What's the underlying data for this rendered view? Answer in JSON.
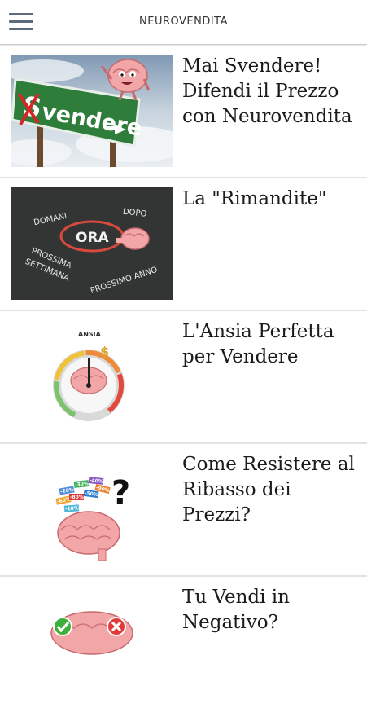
{
  "header": {
    "menu_icon": "hamburger-menu-icon",
    "title": "NEUROVENDITA"
  },
  "articles": [
    {
      "title": "Mai Svendere! Difendi il Prezzo con Neurovendita",
      "image": {
        "sign_text": "vendere",
        "sign_prefix": "S"
      }
    },
    {
      "title": "La \"Rimandite\"",
      "image": {
        "words": [
          "DOMANI",
          "DOPO",
          "ORA",
          "PROSSIMA",
          "SETTIMANA",
          "PROSSIMO ANNO"
        ]
      }
    },
    {
      "title": "L'Ansia Perfetta per Vendere",
      "image": {
        "gauge_label": "ANSIA",
        "symbol": "$"
      }
    },
    {
      "title": "Come Resistere al Ribasso dei Prezzi?",
      "image": {
        "tags": [
          "-20%",
          "-30%",
          "-40%",
          "-60%",
          "-80%",
          "-50%",
          "-90%",
          "-10%"
        ],
        "symbol": "?"
      }
    },
    {
      "title": "Tu Vendi in Negativo?",
      "image": {}
    }
  ]
}
